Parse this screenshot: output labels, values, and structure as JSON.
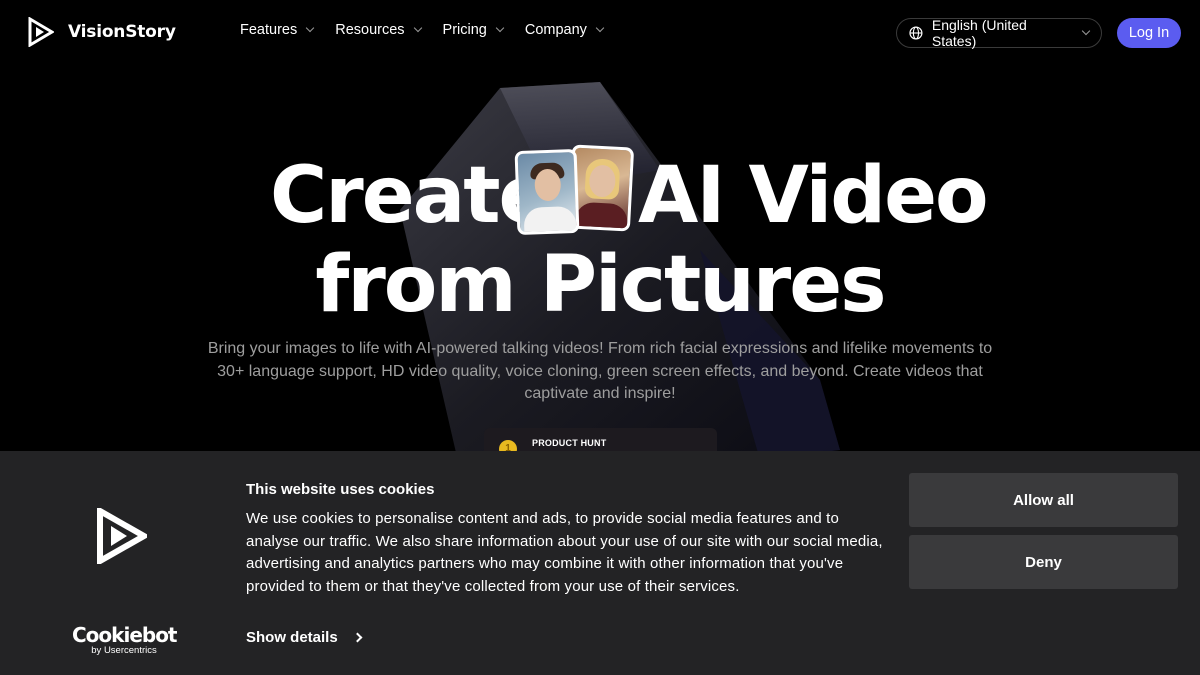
{
  "brand": {
    "name": "VisionStory"
  },
  "nav": {
    "items": [
      {
        "label": "Features"
      },
      {
        "label": "Resources"
      },
      {
        "label": "Pricing"
      },
      {
        "label": "Company"
      }
    ],
    "language": "English (United States)",
    "login_label": "Log In"
  },
  "hero": {
    "line1_word1": "Create",
    "line1_word2": "AI Video",
    "line2": "from Pictures",
    "description": "Bring your images to life with AI-powered talking videos! From rich facial expressions and lifelike movements to 30+ language support, HD video quality, voice cloning, green screen effects, and beyond. Create videos that captivate and inspire!"
  },
  "product_hunt": {
    "label": "PRODUCT HUNT"
  },
  "cookie": {
    "title": "This website uses cookies",
    "text": "We use cookies to personalise content and ads, to provide social media features and to analyse our traffic. We also share information about your use of our site with our social media, advertising and analytics partners who may combine it with other information that you've provided to them or that they've collected from your use of their services.",
    "show_details": "Show details",
    "allow_all": "Allow all",
    "deny": "Deny",
    "provider": "Cookiebot",
    "provider_sub": "by Usercentrics"
  },
  "colors": {
    "accent": "#5b5cf0",
    "banner_bg": "#232325",
    "button_bg": "#3a3a3c"
  }
}
